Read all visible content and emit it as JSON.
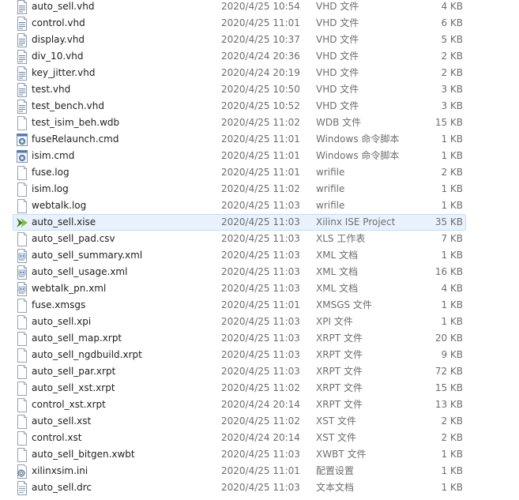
{
  "files": [
    {
      "name": "auto_sell.vhd",
      "date": "2020/4/25 10:54",
      "type": "VHD 文件",
      "size": "4 KB",
      "icon": "document-icon"
    },
    {
      "name": "control.vhd",
      "date": "2020/4/25 11:01",
      "type": "VHD 文件",
      "size": "6 KB",
      "icon": "document-icon"
    },
    {
      "name": "display.vhd",
      "date": "2020/4/25 10:37",
      "type": "VHD 文件",
      "size": "5 KB",
      "icon": "document-icon"
    },
    {
      "name": "div_10.vhd",
      "date": "2020/4/24 20:36",
      "type": "VHD 文件",
      "size": "2 KB",
      "icon": "document-icon"
    },
    {
      "name": "key_jitter.vhd",
      "date": "2020/4/24 20:19",
      "type": "VHD 文件",
      "size": "2 KB",
      "icon": "document-icon"
    },
    {
      "name": "test.vhd",
      "date": "2020/4/25 10:50",
      "type": "VHD 文件",
      "size": "3 KB",
      "icon": "document-icon"
    },
    {
      "name": "test_bench.vhd",
      "date": "2020/4/25 10:52",
      "type": "VHD 文件",
      "size": "3 KB",
      "icon": "document-icon"
    },
    {
      "name": "test_isim_beh.wdb",
      "date": "2020/4/25 11:02",
      "type": "WDB 文件",
      "size": "15 KB",
      "icon": "blank-file-icon"
    },
    {
      "name": "fuseRelaunch.cmd",
      "date": "2020/4/25 11:01",
      "type": "Windows 命令脚本",
      "size": "1 KB",
      "icon": "gear-script-icon"
    },
    {
      "name": "isim.cmd",
      "date": "2020/4/25 11:01",
      "type": "Windows 命令脚本",
      "size": "1 KB",
      "icon": "gear-script-icon"
    },
    {
      "name": "fuse.log",
      "date": "2020/4/25 11:01",
      "type": "wrifile",
      "size": "2 KB",
      "icon": "blank-file-icon"
    },
    {
      "name": "isim.log",
      "date": "2020/4/25 11:02",
      "type": "wrifile",
      "size": "1 KB",
      "icon": "blank-file-icon"
    },
    {
      "name": "webtalk.log",
      "date": "2020/4/25 11:03",
      "type": "wrifile",
      "size": "1 KB",
      "icon": "blank-file-icon"
    },
    {
      "name": "auto_sell.xise",
      "date": "2020/4/25 11:03",
      "type": "Xilinx ISE Project",
      "size": "35 KB",
      "icon": "xilinx-ise-icon"
    },
    {
      "name": "auto_sell_pad.csv",
      "date": "2020/4/25 11:03",
      "type": "XLS 工作表",
      "size": "7 KB",
      "icon": "blank-file-icon"
    },
    {
      "name": "auto_sell_summary.xml",
      "date": "2020/4/25 11:03",
      "type": "XML 文档",
      "size": "1 KB",
      "icon": "xml-document-icon"
    },
    {
      "name": "auto_sell_usage.xml",
      "date": "2020/4/25 11:03",
      "type": "XML 文档",
      "size": "16 KB",
      "icon": "xml-document-icon"
    },
    {
      "name": "webtalk_pn.xml",
      "date": "2020/4/25 11:03",
      "type": "XML 文档",
      "size": "4 KB",
      "icon": "xml-document-icon"
    },
    {
      "name": "fuse.xmsgs",
      "date": "2020/4/25 11:01",
      "type": "XMSGS 文件",
      "size": "1 KB",
      "icon": "blank-file-icon"
    },
    {
      "name": "auto_sell.xpi",
      "date": "2020/4/25 11:03",
      "type": "XPI 文件",
      "size": "1 KB",
      "icon": "blank-file-icon"
    },
    {
      "name": "auto_sell_map.xrpt",
      "date": "2020/4/25 11:03",
      "type": "XRPT 文件",
      "size": "20 KB",
      "icon": "blank-file-icon"
    },
    {
      "name": "auto_sell_ngdbuild.xrpt",
      "date": "2020/4/25 11:03",
      "type": "XRPT 文件",
      "size": "9 KB",
      "icon": "blank-file-icon"
    },
    {
      "name": "auto_sell_par.xrpt",
      "date": "2020/4/25 11:03",
      "type": "XRPT 文件",
      "size": "72 KB",
      "icon": "blank-file-icon"
    },
    {
      "name": "auto_sell_xst.xrpt",
      "date": "2020/4/25 11:02",
      "type": "XRPT 文件",
      "size": "15 KB",
      "icon": "blank-file-icon"
    },
    {
      "name": "control_xst.xrpt",
      "date": "2020/4/24 20:14",
      "type": "XRPT 文件",
      "size": "13 KB",
      "icon": "blank-file-icon"
    },
    {
      "name": "auto_sell.xst",
      "date": "2020/4/25 11:02",
      "type": "XST 文件",
      "size": "2 KB",
      "icon": "blank-file-icon"
    },
    {
      "name": "control.xst",
      "date": "2020/4/24 20:14",
      "type": "XST 文件",
      "size": "2 KB",
      "icon": "blank-file-icon"
    },
    {
      "name": "auto_sell_bitgen.xwbt",
      "date": "2020/4/25 11:03",
      "type": "XWBT 文件",
      "size": "1 KB",
      "icon": "blank-file-icon"
    },
    {
      "name": "xilinxsim.ini",
      "date": "2020/4/25 11:01",
      "type": "配置设置",
      "size": "1 KB",
      "icon": "settings-file-icon"
    },
    {
      "name": "auto_sell.drc",
      "date": "2020/4/25 11:03",
      "type": "文本文档",
      "size": "1 KB",
      "icon": "text-document-icon"
    }
  ],
  "selected_index": 13,
  "colors": {
    "selection_bg": "#e9f2fc",
    "selection_border": "#c4dcf6",
    "secondary_text": "#6d6d6d"
  }
}
